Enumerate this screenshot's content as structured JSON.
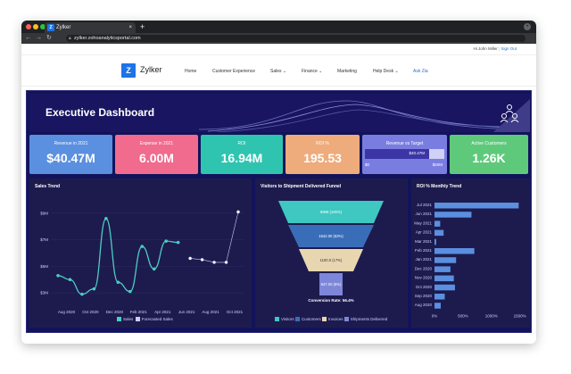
{
  "browser": {
    "tab_title": "Zylker",
    "tab_icon": "Z",
    "url": "zylker.zohoanalyticsportal.com",
    "traffic_lights": [
      "#ff5f57",
      "#febc2e",
      "#28c840"
    ]
  },
  "site": {
    "user_text": "Hi John Miller",
    "sign_out": "Sign Out",
    "logo_letter": "Z",
    "brand": "Zylker",
    "nav": [
      "Home",
      "Customer Experience",
      "Sales ⌄",
      "Finance ⌄",
      "Marketing",
      "Help Desk ⌄",
      "Ask Zia"
    ]
  },
  "dashboard": {
    "title": "Executive Dashboard",
    "kpis": [
      {
        "label": "Revenue in 2021",
        "value": "$40.47M",
        "color": "#5b8fe0"
      },
      {
        "label": "Expense in 2021",
        "value": "6.00M",
        "color": "#f06b8d"
      },
      {
        "label": "ROI",
        "value": "16.94M",
        "color": "#2ec4b0"
      },
      {
        "label": "ROI %",
        "value": "195.53",
        "color": "#eeab7b"
      },
      {
        "label": "Revenue vs Target",
        "value": "$40.47M",
        "color": "#7a7de0",
        "scale_min": "$0",
        "scale_max": "$50M",
        "progress": 0.81
      },
      {
        "label": "Active Customers",
        "value": "1.26K",
        "color": "#5fc97b"
      }
    ]
  },
  "chart_data": [
    {
      "type": "line",
      "title": "Sales Trend",
      "x_ticks": [
        "Aug 2020",
        "Oct 2020",
        "Dec 2020",
        "Feb 2021",
        "Apr 2021",
        "Jun 2021",
        "Aug 2021",
        "Oct 2021"
      ],
      "y_ticks": [
        "$3M",
        "$5M",
        "$7M",
        "$9M"
      ],
      "ylim": [
        2,
        10
      ],
      "series": [
        {
          "name": "Sales",
          "color": "#4dcdc2",
          "x": [
            0,
            1,
            2,
            3,
            4,
            5,
            6,
            7,
            8,
            9,
            10,
            11
          ],
          "values": [
            4.3,
            4.0,
            2.9,
            3.3,
            8.6,
            3.8,
            3.1,
            6.5,
            4.8,
            6.9,
            6.8,
            null
          ]
        },
        {
          "name": "Forecasted Sales",
          "color": "#c7d0ee",
          "x": [
            11,
            12,
            13,
            14,
            15
          ],
          "values": [
            5.6,
            5.5,
            5.3,
            5.3,
            9.1
          ]
        }
      ]
    },
    {
      "type": "funnel",
      "title": "Visitors to Shipment Delivered Funnel",
      "stages": [
        {
          "name": "Visitors",
          "label": "8908 (100%)",
          "color": "#3ec8c1"
        },
        {
          "name": "Customers",
          "label": "1542.00 (63%)",
          "color": "#3a6db8"
        },
        {
          "name": "Invoices",
          "label": "1100.0 (17%)",
          "color": "#e8d6b0"
        },
        {
          "name": "Shipments Delivered",
          "label": "647.00 (6%)",
          "color": "#7d86d8"
        }
      ],
      "note": "Conversion Rate: 56.4%"
    },
    {
      "type": "bar",
      "orientation": "horizontal",
      "title": "ROI % Monthly Trend",
      "categories": [
        "Jul 2021",
        "Jun 2021",
        "May 2021",
        "Apr 2021",
        "Mar 2021",
        "Feb 2021",
        "Jan 2021",
        "Dec 2020",
        "Nov 2020",
        "Oct 2020",
        "Sep 2020",
        "Aug 2020"
      ],
      "values": [
        1480,
        650,
        100,
        160,
        30,
        700,
        380,
        280,
        340,
        360,
        180,
        110
      ],
      "x_ticks": [
        "0%",
        "500%",
        "1000%",
        "1500%"
      ],
      "xlim": [
        0,
        1600
      ],
      "color": "#5b8fe0"
    }
  ]
}
